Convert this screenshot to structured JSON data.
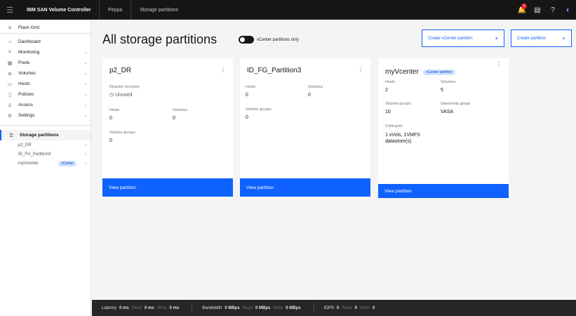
{
  "topbar": {
    "product": "IBM SAN Volume Controller",
    "tabs": [
      "Peppa",
      "Storage partitions"
    ],
    "notification_count": "2"
  },
  "sidebar": {
    "header": "Flash Grid",
    "items": [
      {
        "label": "Dashboard",
        "icon": "dashboard-icon"
      },
      {
        "label": "Monitoring",
        "icon": "chart-icon"
      },
      {
        "label": "Pools",
        "icon": "pools-icon"
      },
      {
        "label": "Volumes",
        "icon": "volumes-icon"
      },
      {
        "label": "Hosts",
        "icon": "hosts-icon"
      },
      {
        "label": "Policies",
        "icon": "policies-icon"
      },
      {
        "label": "Access",
        "icon": "access-icon"
      },
      {
        "label": "Settings",
        "icon": "settings-icon"
      }
    ],
    "active": "Storage partitions",
    "sub_items": [
      {
        "label": "p2_DR"
      },
      {
        "label": "ID_FG_Partition3"
      },
      {
        "label": "myVcenter",
        "tag": "vCenter"
      }
    ]
  },
  "main": {
    "title": "All storage partitions",
    "toggle_label": "vCenter partitions only",
    "btn_vcenter": "Create vCenter partition",
    "btn_create": "Create partition",
    "plus": "+"
  },
  "cards": [
    {
      "title": "p2_DR",
      "dr_label": "Disaster recovery",
      "dr_value": "Unused",
      "hosts_label": "Hosts",
      "hosts_value": "0",
      "volumes_label": "Volumes",
      "volumes_value": "0",
      "vg_label": "Volume groups",
      "vg_value": "0",
      "view": "View partition"
    },
    {
      "title": "ID_FG_Partition3",
      "hosts_label": "Hosts",
      "hosts_value": "0",
      "volumes_label": "Volumes",
      "volumes_value": "0",
      "vg_label": "Volume groups",
      "vg_value": "0",
      "view": "View partition"
    },
    {
      "title": "myVcenter",
      "tag": "vCenter partition",
      "hosts_label": "Hosts",
      "hosts_value": "2",
      "volumes_label": "Volumes",
      "volumes_value": "5",
      "vg_label": "Volume groups",
      "vg_value": "10",
      "og_label": "Ownership group",
      "og_value": "VASA",
      "cp_label": "Child pool",
      "cp_value": "1 vVols, 1VMFS datastore(s)",
      "view": "View partition"
    }
  ],
  "status": {
    "latency_label": "Latency",
    "latency": "0 ms",
    "latency_read_label": "Read",
    "latency_read": "0 ms",
    "latency_write_label": "Write",
    "latency_write": "0 ms",
    "bw_label": "Bandwidth",
    "bw": "0 MBps",
    "bw_read_label": "Read",
    "bw_read": "0 MBps",
    "bw_write_label": "Write",
    "bw_write": "0 MBps",
    "iops_label": "IOPS",
    "iops": "0",
    "iops_read_label": "Read",
    "iops_read": "0",
    "iops_write_label": "Write",
    "iops_write": "0"
  }
}
